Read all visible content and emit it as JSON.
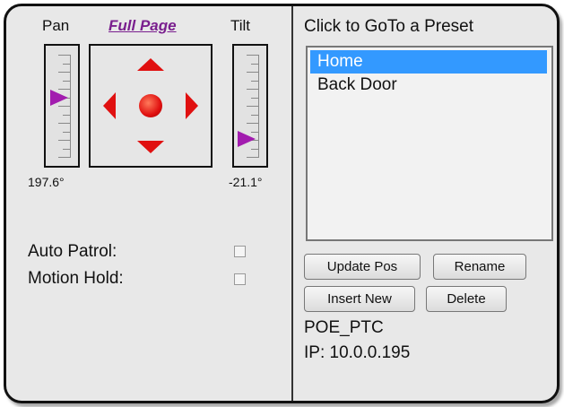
{
  "ptz": {
    "pan_label": "Pan",
    "full_page_link": "Full Page",
    "tilt_label": "Tilt",
    "pan_value": "197.6°",
    "tilt_value": "-21.1°",
    "pan_level_fraction": 0.42,
    "tilt_level_fraction": 0.82,
    "arrow_color": "#e01010",
    "thumb_color": "#a21caf"
  },
  "options": {
    "auto_patrol_label": "Auto Patrol:",
    "auto_patrol_checked": false,
    "motion_hold_label": "Motion Hold:",
    "motion_hold_checked": false
  },
  "presets": {
    "title": "Click to GoTo a Preset",
    "items": [
      "Home",
      "Back Door"
    ],
    "selected_index": 0,
    "selection_color": "#3399ff"
  },
  "buttons": {
    "update_pos": "Update Pos",
    "rename": "Rename",
    "insert_new": "Insert New",
    "delete": "Delete"
  },
  "device": {
    "name": "POE_PTC",
    "ip": "IP: 10.0.0.195"
  }
}
